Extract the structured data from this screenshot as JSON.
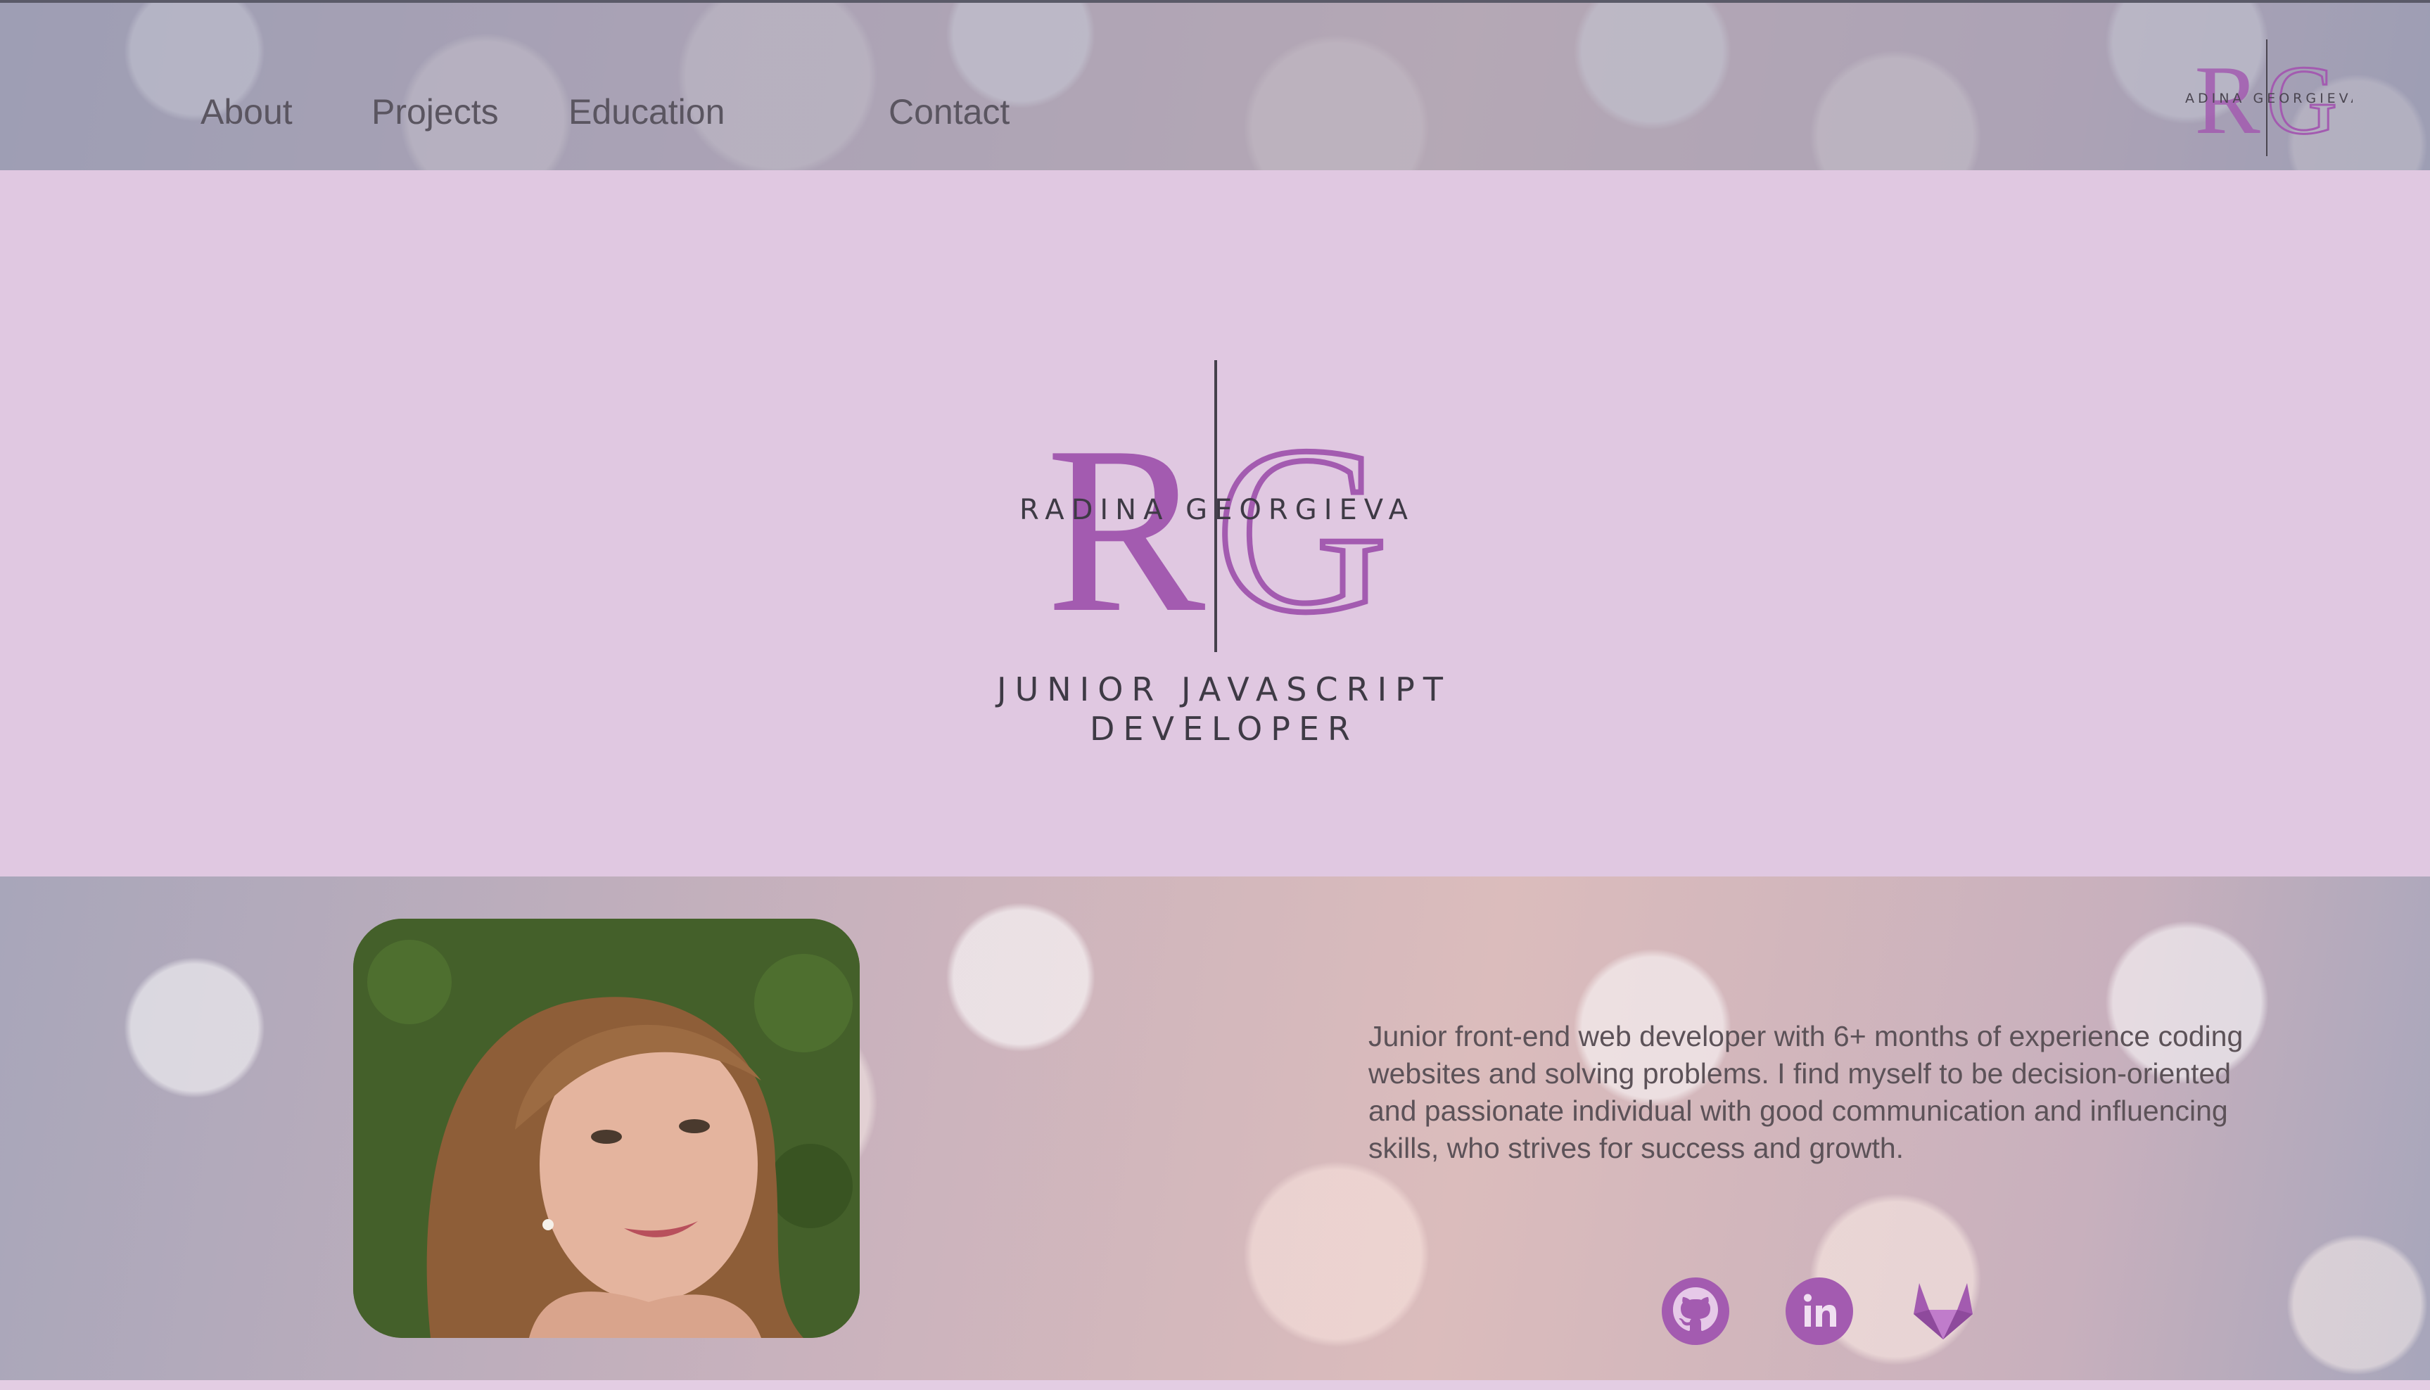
{
  "nav": {
    "items": [
      {
        "label": "About"
      },
      {
        "label": "Projects"
      },
      {
        "label": "Education"
      },
      {
        "label": "Contact"
      }
    ]
  },
  "brand": {
    "initials_left": "R",
    "initials_right": "G",
    "name": "RADINA GEORGIEVA",
    "tagline_line1": "JUNIOR JAVASCRIPT",
    "tagline_line2": "DEVELOPER"
  },
  "about": {
    "bio": "Junior front-end web developer with 6+ months of experience coding websites and solving problems. I find myself to be decision-oriented and passionate individual with good communication and influencing skills, who strives for success and growth."
  },
  "socials": [
    {
      "icon": "github-icon"
    },
    {
      "icon": "linkedin-icon"
    },
    {
      "icon": "gitlab-icon"
    }
  ],
  "colors": {
    "accent": "#a35bb0",
    "hero_bg": "#e0c8e1",
    "text": "#5c5258"
  }
}
